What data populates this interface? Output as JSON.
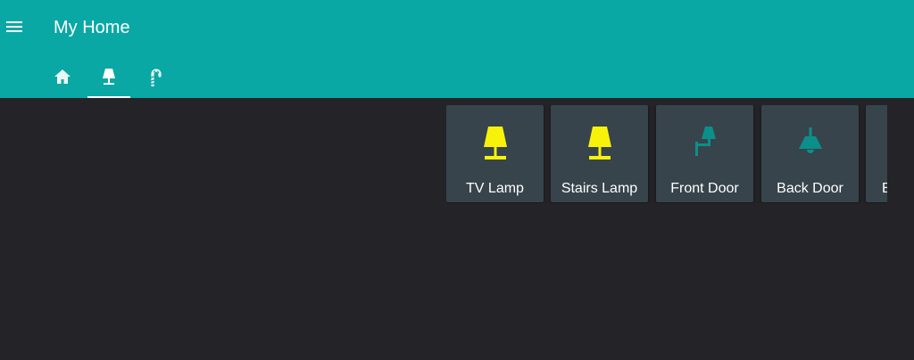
{
  "header": {
    "title": "My Home",
    "background_color": "#09a8a4",
    "menu_icon": "menu-icon"
  },
  "tabs": [
    {
      "icon": "home-icon",
      "active": false
    },
    {
      "icon": "lamp-icon",
      "active": true
    },
    {
      "icon": "candy-cane-icon",
      "active": false
    }
  ],
  "cards": [
    {
      "label": "TV Lamp",
      "icon": "lamp-icon",
      "state": "on",
      "icon_color": "#f8f20b"
    },
    {
      "label": "Stairs Lamp",
      "icon": "lamp-icon",
      "state": "on",
      "icon_color": "#f8f20b"
    },
    {
      "label": "Front Door",
      "icon": "wall-sconce-icon",
      "state": "off",
      "icon_color": "#0b8f8b"
    },
    {
      "label": "Back Door",
      "icon": "ceiling-light-icon",
      "state": "off",
      "icon_color": "#0b8f8b"
    },
    {
      "label": "B",
      "icon": "",
      "state": "",
      "icon_color": ""
    }
  ],
  "colors": {
    "background": "#232328",
    "card": "#37444b",
    "light_on": "#f8f20b",
    "light_off": "#0b8f8b"
  }
}
